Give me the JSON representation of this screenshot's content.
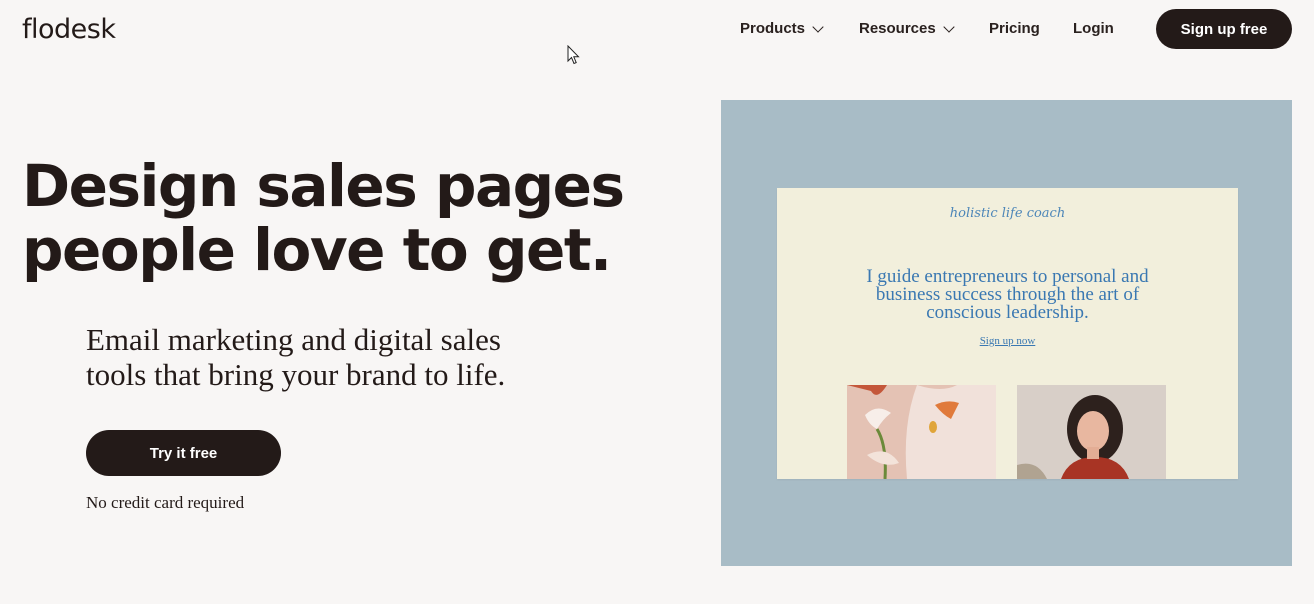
{
  "header": {
    "logo": "flodesk",
    "nav": [
      {
        "label": "Products"
      },
      {
        "label": "Resources"
      },
      {
        "label": "Pricing"
      },
      {
        "label": "Login"
      }
    ],
    "signup_label": "Sign up free"
  },
  "hero": {
    "headline_line1": "Design sales pages",
    "headline_line2": "people love to get.",
    "subhead_line1": "Email marketing and digital sales",
    "subhead_line2": "tools that bring your brand to life.",
    "cta_label": "Try it free",
    "note": "No credit card required"
  },
  "preview": {
    "tagline": "holistic life coach",
    "text_line1": "I guide entrepreneurs to personal and",
    "text_line2": "business success through the art of",
    "text_line3": "conscious leadership.",
    "link": "Sign up now"
  },
  "colors": {
    "background": "#f8f6f5",
    "dark": "#231a18",
    "preview_bg": "#a8bcc6",
    "card_bg": "#f2efdc",
    "card_accent": "#3a78b2"
  },
  "icons": [
    "chevron-down-icon",
    "mouse-cursor-icon"
  ]
}
